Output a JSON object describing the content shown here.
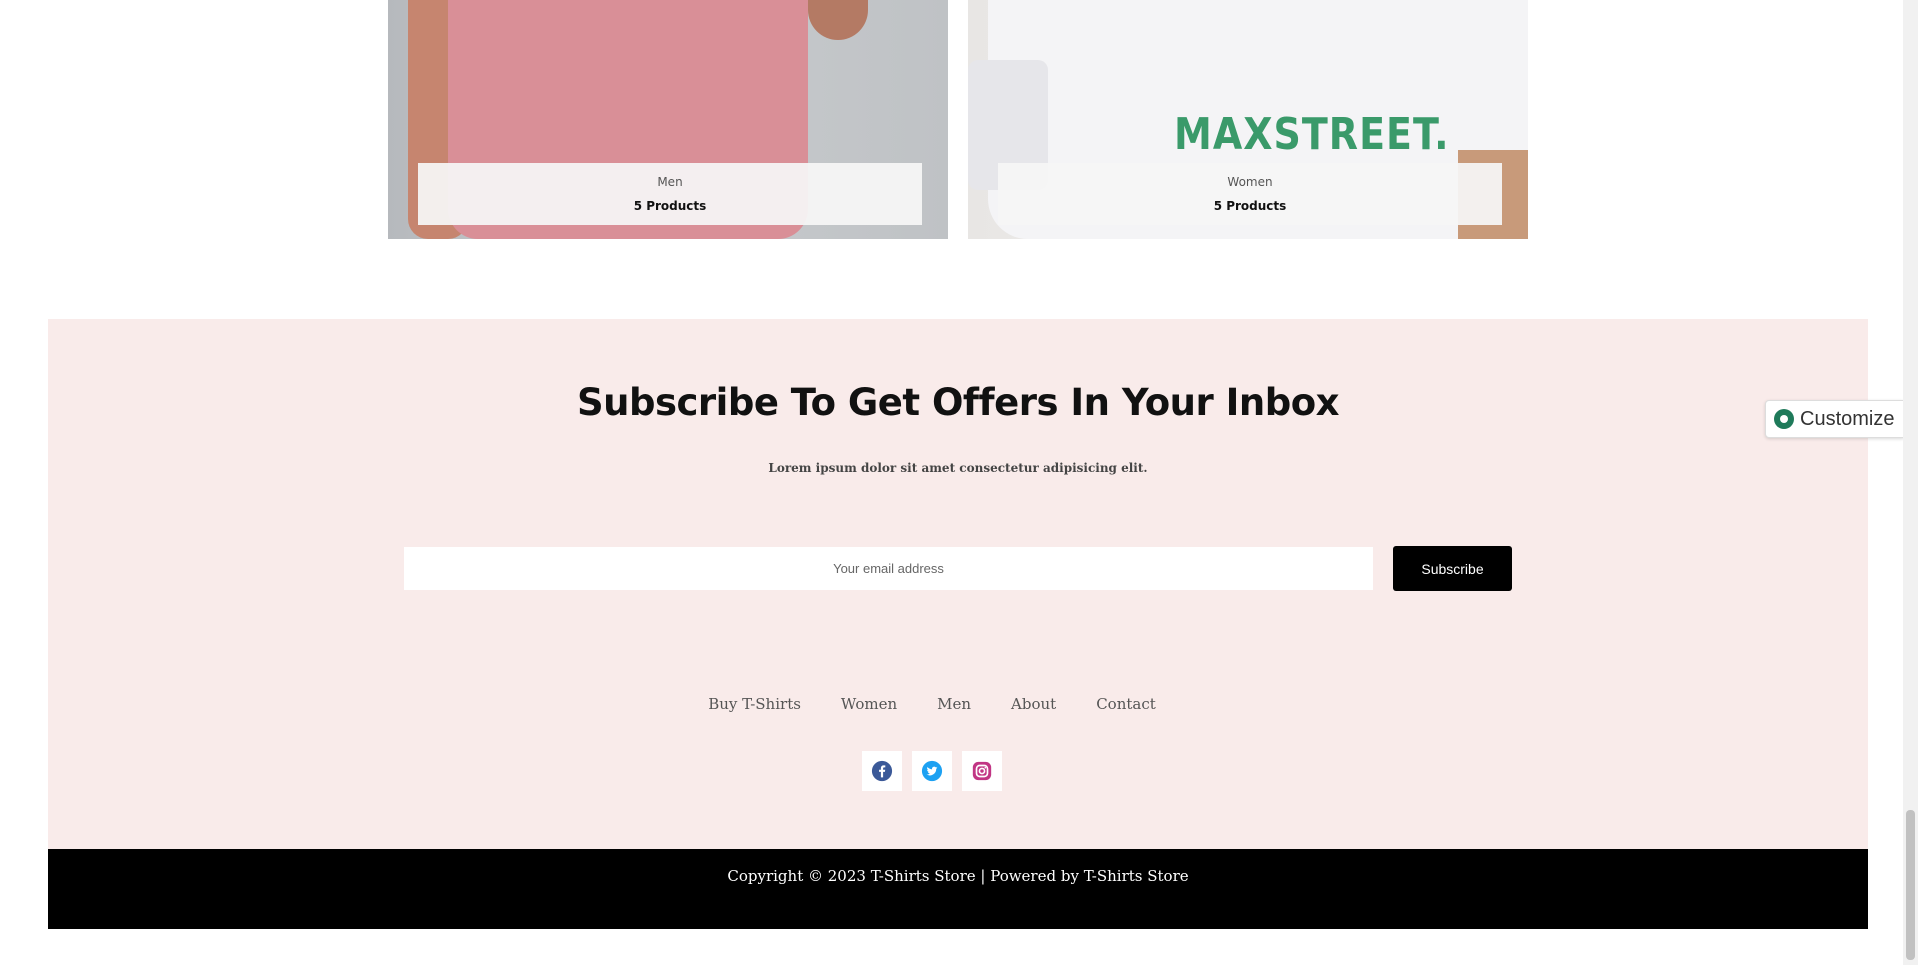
{
  "categories": [
    {
      "name": "Men",
      "count": "5 Products"
    },
    {
      "name": "Women",
      "count": "5 Products",
      "shirt_print": "MAXSTREET."
    }
  ],
  "subscribe": {
    "title": "Subscribe To Get Offers In Your Inbox",
    "description": "Lorem ipsum dolor sit amet consectetur adipisicing elit.",
    "email_placeholder": "Your email address",
    "button_label": "Subscribe"
  },
  "footer_nav": [
    "Buy T-Shirts",
    "Women",
    "Men",
    "About",
    "Contact"
  ],
  "social": [
    {
      "icon": "facebook-icon",
      "color": "#3b5998"
    },
    {
      "icon": "twitter-icon",
      "color": "#1da1f2"
    },
    {
      "icon": "instagram-icon",
      "color": "#c13584"
    }
  ],
  "footer": {
    "copyright": "Copyright © 2023 T-Shirts Store | Powered by T-Shirts Store"
  },
  "customize": {
    "label": "Customize"
  },
  "colors": {
    "subscribe_bg": "#f9ebea",
    "button_bg": "#000000",
    "footer_bg": "#000000"
  }
}
